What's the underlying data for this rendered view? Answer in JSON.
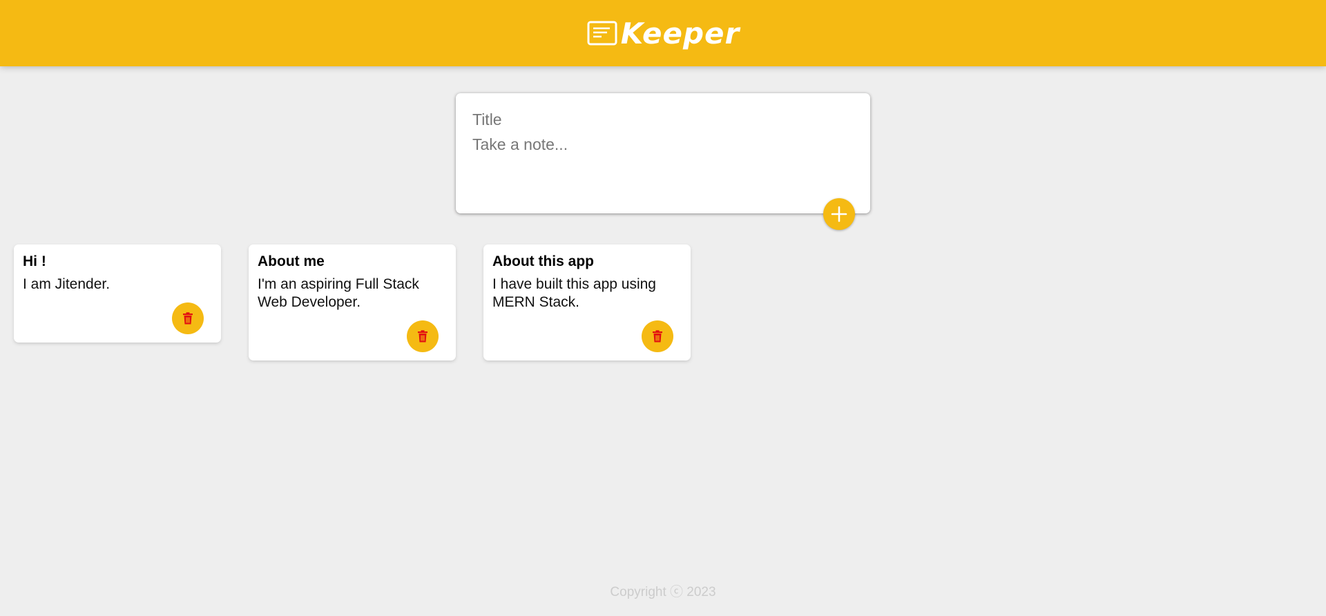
{
  "header": {
    "title": "Keeper",
    "icon": "note-icon",
    "background": "#f5ba13"
  },
  "create_note": {
    "title_placeholder": "Title",
    "content_placeholder": "Take a note...",
    "title_value": "",
    "content_value": "",
    "add_icon": "plus-icon"
  },
  "notes": [
    {
      "title": "Hi !",
      "content": "I am Jitender.",
      "delete_icon": "trash-icon"
    },
    {
      "title": "About me",
      "content": "I'm an aspiring Full Stack Web Developer.",
      "delete_icon": "trash-icon"
    },
    {
      "title": "About this app",
      "content": "I have built this app using MERN Stack.",
      "delete_icon": "trash-icon"
    }
  ],
  "footer": {
    "copyright": "Copyright ⓒ 2023"
  },
  "colors": {
    "accent": "#f5ba13",
    "background": "#eeeeee",
    "delete_icon": "#e21010"
  }
}
